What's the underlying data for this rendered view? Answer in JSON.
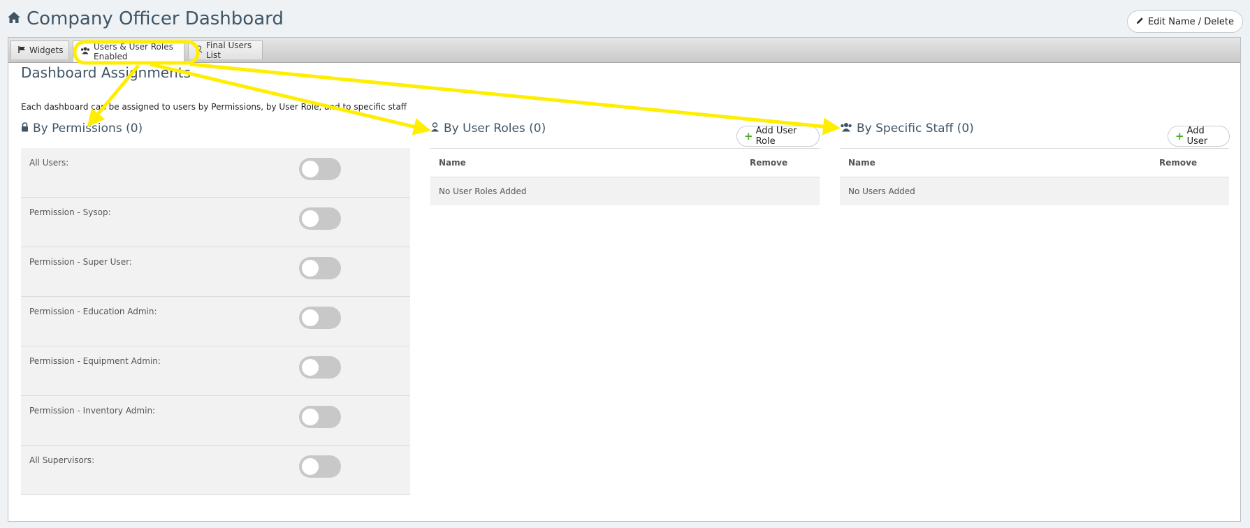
{
  "header": {
    "title": "Company Officer Dashboard",
    "edit_label": "Edit Name / Delete"
  },
  "tabs": [
    {
      "label": "Widgets"
    },
    {
      "label": "Users & User Roles Enabled"
    },
    {
      "label": "Final Users List"
    }
  ],
  "section": {
    "title": "Dashboard Assignments",
    "description": "Each dashboard can be assigned to users by Permissions, by User Role, and to specific staff"
  },
  "permissions": {
    "title": "By Permissions (0)",
    "items": [
      {
        "label": "All Users:",
        "enabled": false
      },
      {
        "label": "Permission - Sysop:",
        "enabled": false
      },
      {
        "label": "Permission - Super User:",
        "enabled": false
      },
      {
        "label": "Permission - Education Admin:",
        "enabled": false
      },
      {
        "label": "Permission - Equipment Admin:",
        "enabled": false
      },
      {
        "label": "Permission - Inventory Admin:",
        "enabled": false
      },
      {
        "label": "All Supervisors:",
        "enabled": false
      }
    ]
  },
  "user_roles": {
    "title": "By User Roles (0)",
    "add_label": "Add User Role",
    "col_name": "Name",
    "col_remove": "Remove",
    "empty": "No User Roles Added"
  },
  "staff": {
    "title": "By Specific Staff (0)",
    "add_label": "Add User",
    "col_name": "Name",
    "col_remove": "Remove",
    "empty": "No Users Added"
  },
  "colors": {
    "annotation": "#ffee00",
    "accent_green": "#4caa2a",
    "title": "#3f5566"
  }
}
